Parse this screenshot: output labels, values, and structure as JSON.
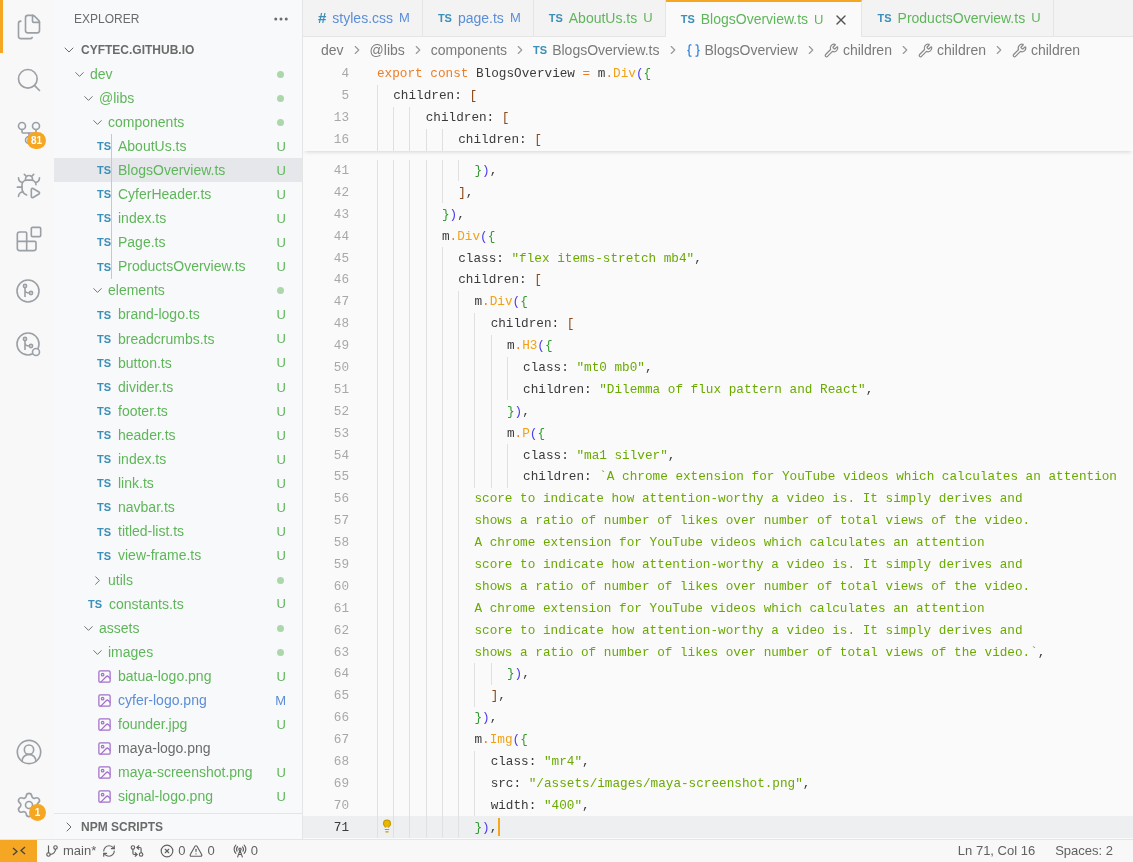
{
  "activity_bar": {
    "top": [
      {
        "kind": "explorer",
        "selected": true
      },
      {
        "kind": "search",
        "selected": false
      },
      {
        "kind": "source-control",
        "selected": false,
        "badge": "81"
      },
      {
        "kind": "run-debug",
        "selected": false
      },
      {
        "kind": "extensions",
        "selected": false
      },
      {
        "kind": "git-graph",
        "selected": false
      },
      {
        "kind": "remote",
        "selected": false
      }
    ],
    "bottom": [
      {
        "kind": "accounts",
        "selected": false
      },
      {
        "kind": "manage",
        "selected": false,
        "badge": "1"
      }
    ]
  },
  "sidebar": {
    "title": "EXPLORER",
    "root": {
      "label": "CYFTEC.GITHUB.IO",
      "expanded": true,
      "children": [
        {
          "kind": "folder",
          "label": "dev",
          "color": "#5fb65a",
          "expanded": true,
          "selected": false,
          "children": [
            {
              "kind": "folder",
              "label": "@libs",
              "color": "#5fb65a",
              "expanded": true,
              "selected": false,
              "children": [
                {
                  "kind": "folder",
                  "label": "components",
                  "color": "#5fb65a",
                  "expanded": true,
                  "selected": false,
                  "children": [
                    {
                      "kind": "ts",
                      "icon": "TS",
                      "label": "AboutUs.ts",
                      "color": "#5fb65a",
                      "badge": "U",
                      "selected": false
                    },
                    {
                      "kind": "ts",
                      "icon": "TS",
                      "label": "BlogsOverview.ts",
                      "color": "#5fb65a",
                      "badge": "U",
                      "selected": true
                    },
                    {
                      "kind": "ts",
                      "icon": "TS",
                      "label": "CyferHeader.ts",
                      "color": "#5fb65a",
                      "badge": "U",
                      "selected": false
                    },
                    {
                      "kind": "ts",
                      "icon": "TS",
                      "label": "index.ts",
                      "color": "#5fb65a",
                      "badge": "U",
                      "selected": false
                    },
                    {
                      "kind": "ts",
                      "icon": "TS",
                      "label": "Page.ts",
                      "color": "#5fb65a",
                      "badge": "U",
                      "selected": false
                    },
                    {
                      "kind": "ts",
                      "icon": "TS",
                      "label": "ProductsOverview.ts",
                      "color": "#5fb65a",
                      "badge": "U",
                      "selected": false
                    }
                  ]
                },
                {
                  "kind": "folder",
                  "label": "elements",
                  "color": "#5fb65a",
                  "expanded": true,
                  "selected": false,
                  "children": [
                    {
                      "kind": "ts",
                      "icon": "TS",
                      "label": "brand-logo.ts",
                      "color": "#5fb65a",
                      "badge": "U",
                      "selected": false
                    },
                    {
                      "kind": "ts",
                      "icon": "TS",
                      "label": "breadcrumbs.ts",
                      "color": "#5fb65a",
                      "badge": "U",
                      "selected": false
                    },
                    {
                      "kind": "ts",
                      "icon": "TS",
                      "label": "button.ts",
                      "color": "#5fb65a",
                      "badge": "U",
                      "selected": false
                    },
                    {
                      "kind": "ts",
                      "icon": "TS",
                      "label": "divider.ts",
                      "color": "#5fb65a",
                      "badge": "U",
                      "selected": false
                    },
                    {
                      "kind": "ts",
                      "icon": "TS",
                      "label": "footer.ts",
                      "color": "#5fb65a",
                      "badge": "U",
                      "selected": false
                    },
                    {
                      "kind": "ts",
                      "icon": "TS",
                      "label": "header.ts",
                      "color": "#5fb65a",
                      "badge": "U",
                      "selected": false
                    },
                    {
                      "kind": "ts",
                      "icon": "TS",
                      "label": "index.ts",
                      "color": "#5fb65a",
                      "badge": "U",
                      "selected": false
                    },
                    {
                      "kind": "ts",
                      "icon": "TS",
                      "label": "link.ts",
                      "color": "#5fb65a",
                      "badge": "U",
                      "selected": false
                    },
                    {
                      "kind": "ts",
                      "icon": "TS",
                      "label": "navbar.ts",
                      "color": "#5fb65a",
                      "badge": "U",
                      "selected": false
                    },
                    {
                      "kind": "ts",
                      "icon": "TS",
                      "label": "titled-list.ts",
                      "color": "#5fb65a",
                      "badge": "U",
                      "selected": false
                    },
                    {
                      "kind": "ts",
                      "icon": "TS",
                      "label": "view-frame.ts",
                      "color": "#5fb65a",
                      "badge": "U",
                      "selected": false
                    }
                  ]
                },
                {
                  "kind": "folder",
                  "label": "utils",
                  "color": "#5fb65a",
                  "expanded": false,
                  "selected": false
                },
                {
                  "kind": "ts",
                  "icon": "TS",
                  "label": "constants.ts",
                  "color": "#5fb65a",
                  "badge": "U",
                  "selected": false
                }
              ]
            },
            {
              "kind": "folder",
              "label": "assets",
              "color": "#5fb65a",
              "expanded": true,
              "selected": false,
              "children": [
                {
                  "kind": "folder",
                  "label": "images",
                  "color": "#5fb65a",
                  "expanded": true,
                  "selected": false,
                  "children": [
                    {
                      "kind": "image",
                      "label": "batua-logo.png",
                      "color": "#5fb65a",
                      "badge": "U",
                      "selected": false
                    },
                    {
                      "kind": "image",
                      "label": "cyfer-logo.png",
                      "color": "#5b8ed6",
                      "badge": "M",
                      "selected": false
                    },
                    {
                      "kind": "image",
                      "label": "founder.jpg",
                      "color": "#5fb65a",
                      "badge": "U",
                      "selected": false
                    },
                    {
                      "kind": "image",
                      "label": "maya-logo.png",
                      "color": "#6b6b6b",
                      "selected": false
                    },
                    {
                      "kind": "image",
                      "label": "maya-screenshot.png",
                      "color": "#5fb65a",
                      "badge": "U",
                      "selected": false
                    },
                    {
                      "kind": "image",
                      "label": "signal-logo.png",
                      "color": "#5fb65a",
                      "badge": "U",
                      "selected": false
                    }
                  ]
                }
              ]
            }
          ]
        }
      ]
    },
    "sections": [
      {
        "label": "NPM SCRIPTS",
        "expanded": false
      }
    ]
  },
  "tabs": [
    {
      "icon": "#",
      "label": "styles.css",
      "badge": "M",
      "color": "#5b8ed6",
      "selected": false
    },
    {
      "icon": "TS",
      "label": "page.ts",
      "badge": "M",
      "color": "#5b8ed6",
      "selected": false
    },
    {
      "icon": "TS",
      "label": "AboutUs.ts",
      "badge": "U",
      "color": "#5fb65a",
      "selected": false
    },
    {
      "icon": "TS",
      "label": "BlogsOverview.ts",
      "badge": "U",
      "color": "#5fb65a",
      "selected": true
    },
    {
      "icon": "TS",
      "label": "ProductsOverview.ts",
      "badge": "U",
      "color": "#5fb65a",
      "selected": false
    }
  ],
  "breadcrumbs": [
    {
      "kind": "folder",
      "label": "dev"
    },
    {
      "kind": "folder",
      "label": "@libs"
    },
    {
      "kind": "folder",
      "label": "components"
    },
    {
      "kind": "ts",
      "icon": "TS",
      "label": "BlogsOverview.ts"
    },
    {
      "kind": "variable",
      "label": "BlogsOverview"
    },
    {
      "kind": "property",
      "label": "children"
    },
    {
      "kind": "property",
      "label": "children"
    },
    {
      "kind": "property",
      "label": "children"
    }
  ],
  "sticky_lines": [
    {
      "number": "4",
      "tokens": [
        {
          "kind": "keyword",
          "text": "export const"
        },
        {
          "kind": "plain",
          "text": " BlogsOverview "
        },
        {
          "kind": "operator",
          "text": "="
        },
        {
          "kind": "plain",
          "text": " m"
        },
        {
          "kind": "operator",
          "text": "."
        },
        {
          "kind": "function",
          "text": "Div"
        },
        {
          "kind": "paren",
          "text": "("
        },
        {
          "kind": "brace",
          "text": "{"
        }
      ]
    },
    {
      "number": "5",
      "tokens": [
        {
          "kind": "plain",
          "text": "  children: "
        },
        {
          "kind": "bracket",
          "text": "["
        }
      ]
    },
    {
      "number": "13",
      "tokens": [
        {
          "kind": "plain",
          "text": "      children: "
        },
        {
          "kind": "bracket",
          "text": "["
        }
      ]
    },
    {
      "number": "16",
      "tokens": [
        {
          "kind": "plain",
          "text": "          children: "
        },
        {
          "kind": "bracket",
          "text": "["
        }
      ]
    }
  ],
  "lines": [
    {
      "number": "41",
      "current": false,
      "tokens": [
        {
          "kind": "brace",
          "text": "            }"
        },
        {
          "kind": "paren",
          "text": ")"
        },
        {
          "kind": "plain",
          "text": ","
        }
      ]
    },
    {
      "number": "42",
      "current": false,
      "tokens": [
        {
          "kind": "bracket",
          "text": "          ]"
        },
        {
          "kind": "plain",
          "text": ","
        }
      ]
    },
    {
      "number": "43",
      "current": false,
      "tokens": [
        {
          "kind": "brace",
          "text": "        }"
        },
        {
          "kind": "paren",
          "text": ")"
        },
        {
          "kind": "plain",
          "text": ","
        }
      ]
    },
    {
      "number": "44",
      "current": false,
      "tokens": [
        {
          "kind": "plain",
          "text": "        m"
        },
        {
          "kind": "operator",
          "text": "."
        },
        {
          "kind": "function",
          "text": "Div"
        },
        {
          "kind": "paren",
          "text": "("
        },
        {
          "kind": "brace",
          "text": "{"
        }
      ]
    },
    {
      "number": "45",
      "current": false,
      "tokens": [
        {
          "kind": "plain",
          "text": "          class: "
        },
        {
          "kind": "string",
          "text": "\"flex items-stretch mb4\""
        },
        {
          "kind": "plain",
          "text": ","
        }
      ]
    },
    {
      "number": "46",
      "current": false,
      "tokens": [
        {
          "kind": "plain",
          "text": "          children: "
        },
        {
          "kind": "bracket",
          "text": "["
        }
      ]
    },
    {
      "number": "47",
      "current": false,
      "tokens": [
        {
          "kind": "plain",
          "text": "            m"
        },
        {
          "kind": "operator",
          "text": "."
        },
        {
          "kind": "function",
          "text": "Div"
        },
        {
          "kind": "paren",
          "text": "("
        },
        {
          "kind": "brace",
          "text": "{"
        }
      ]
    },
    {
      "number": "48",
      "current": false,
      "tokens": [
        {
          "kind": "plain",
          "text": "              children: "
        },
        {
          "kind": "bracket",
          "text": "["
        }
      ]
    },
    {
      "number": "49",
      "current": false,
      "tokens": [
        {
          "kind": "plain",
          "text": "                m"
        },
        {
          "kind": "operator",
          "text": "."
        },
        {
          "kind": "function",
          "text": "H3"
        },
        {
          "kind": "paren",
          "text": "("
        },
        {
          "kind": "brace",
          "text": "{"
        }
      ]
    },
    {
      "number": "50",
      "current": false,
      "tokens": [
        {
          "kind": "plain",
          "text": "                  class: "
        },
        {
          "kind": "string",
          "text": "\"mt0 mb0\""
        },
        {
          "kind": "plain",
          "text": ","
        }
      ]
    },
    {
      "number": "51",
      "current": false,
      "tokens": [
        {
          "kind": "plain",
          "text": "                  children: "
        },
        {
          "kind": "string",
          "text": "\"Dilemma of flux pattern and React\""
        },
        {
          "kind": "plain",
          "text": ","
        }
      ]
    },
    {
      "number": "52",
      "current": false,
      "tokens": [
        {
          "kind": "brace",
          "text": "                }"
        },
        {
          "kind": "paren",
          "text": ")"
        },
        {
          "kind": "plain",
          "text": ","
        }
      ]
    },
    {
      "number": "53",
      "current": false,
      "tokens": [
        {
          "kind": "plain",
          "text": "                m"
        },
        {
          "kind": "operator",
          "text": "."
        },
        {
          "kind": "function",
          "text": "P"
        },
        {
          "kind": "paren",
          "text": "("
        },
        {
          "kind": "brace",
          "text": "{"
        }
      ]
    },
    {
      "number": "54",
      "current": false,
      "tokens": [
        {
          "kind": "plain",
          "text": "                  class: "
        },
        {
          "kind": "string",
          "text": "\"ma1 silver\""
        },
        {
          "kind": "plain",
          "text": ","
        }
      ]
    },
    {
      "number": "55",
      "current": false,
      "tokens": [
        {
          "kind": "plain",
          "text": "                  children: "
        },
        {
          "kind": "string",
          "text": "`A chrome extension for YouTube videos which calculates an attention"
        }
      ]
    },
    {
      "number": "56",
      "current": false,
      "tokens": [
        {
          "kind": "string",
          "text": "            score to indicate how attention-worthy a video is. It simply derives and"
        }
      ]
    },
    {
      "number": "57",
      "current": false,
      "tokens": [
        {
          "kind": "string",
          "text": "            shows a ratio of number of likes over number of total views of the video."
        }
      ]
    },
    {
      "number": "58",
      "current": false,
      "tokens": [
        {
          "kind": "string",
          "text": "            A chrome extension for YouTube videos which calculates an attention"
        }
      ]
    },
    {
      "number": "59",
      "current": false,
      "tokens": [
        {
          "kind": "string",
          "text": "            score to indicate how attention-worthy a video is. It simply derives and"
        }
      ]
    },
    {
      "number": "60",
      "current": false,
      "tokens": [
        {
          "kind": "string",
          "text": "            shows a ratio of number of likes over number of total views of the video."
        }
      ]
    },
    {
      "number": "61",
      "current": false,
      "tokens": [
        {
          "kind": "string",
          "text": "            A chrome extension for YouTube videos which calculates an attention"
        }
      ]
    },
    {
      "number": "62",
      "current": false,
      "tokens": [
        {
          "kind": "string",
          "text": "            score to indicate how attention-worthy a video is. It simply derives and"
        }
      ]
    },
    {
      "number": "63",
      "current": false,
      "tokens": [
        {
          "kind": "string",
          "text": "            shows a ratio of number of likes over number of total views of the video.`"
        },
        {
          "kind": "plain",
          "text": ","
        }
      ]
    },
    {
      "number": "64",
      "current": false,
      "tokens": [
        {
          "kind": "brace",
          "text": "                }"
        },
        {
          "kind": "paren",
          "text": ")"
        },
        {
          "kind": "plain",
          "text": ","
        }
      ]
    },
    {
      "number": "65",
      "current": false,
      "tokens": [
        {
          "kind": "bracket",
          "text": "              ]"
        },
        {
          "kind": "plain",
          "text": ","
        }
      ]
    },
    {
      "number": "66",
      "current": false,
      "tokens": [
        {
          "kind": "brace",
          "text": "            }"
        },
        {
          "kind": "paren",
          "text": ")"
        },
        {
          "kind": "plain",
          "text": ","
        }
      ]
    },
    {
      "number": "67",
      "current": false,
      "tokens": [
        {
          "kind": "plain",
          "text": "            m"
        },
        {
          "kind": "operator",
          "text": "."
        },
        {
          "kind": "function",
          "text": "Img"
        },
        {
          "kind": "paren",
          "text": "("
        },
        {
          "kind": "brace",
          "text": "{"
        }
      ]
    },
    {
      "number": "68",
      "current": false,
      "tokens": [
        {
          "kind": "plain",
          "text": "              class: "
        },
        {
          "kind": "string",
          "text": "\"mr4\""
        },
        {
          "kind": "plain",
          "text": ","
        }
      ]
    },
    {
      "number": "69",
      "current": false,
      "tokens": [
        {
          "kind": "plain",
          "text": "              src: "
        },
        {
          "kind": "string",
          "text": "\"/assets/images/maya-screenshot.png\""
        },
        {
          "kind": "plain",
          "text": ","
        }
      ]
    },
    {
      "number": "70",
      "current": false,
      "tokens": [
        {
          "kind": "plain",
          "text": "              width: "
        },
        {
          "kind": "string",
          "text": "\"400\""
        },
        {
          "kind": "plain",
          "text": ","
        }
      ]
    },
    {
      "number": "71",
      "current": true,
      "tokens": [
        {
          "kind": "brace",
          "text": "            }"
        },
        {
          "kind": "paren",
          "text": ")"
        },
        {
          "kind": "plain",
          "text": ","
        }
      ]
    }
  ],
  "status_bar": {
    "branch": "main*",
    "errors": "0",
    "warnings": "0",
    "ports": "0",
    "position": "Ln 71, Col 16",
    "indentation": "Spaces: 2"
  }
}
